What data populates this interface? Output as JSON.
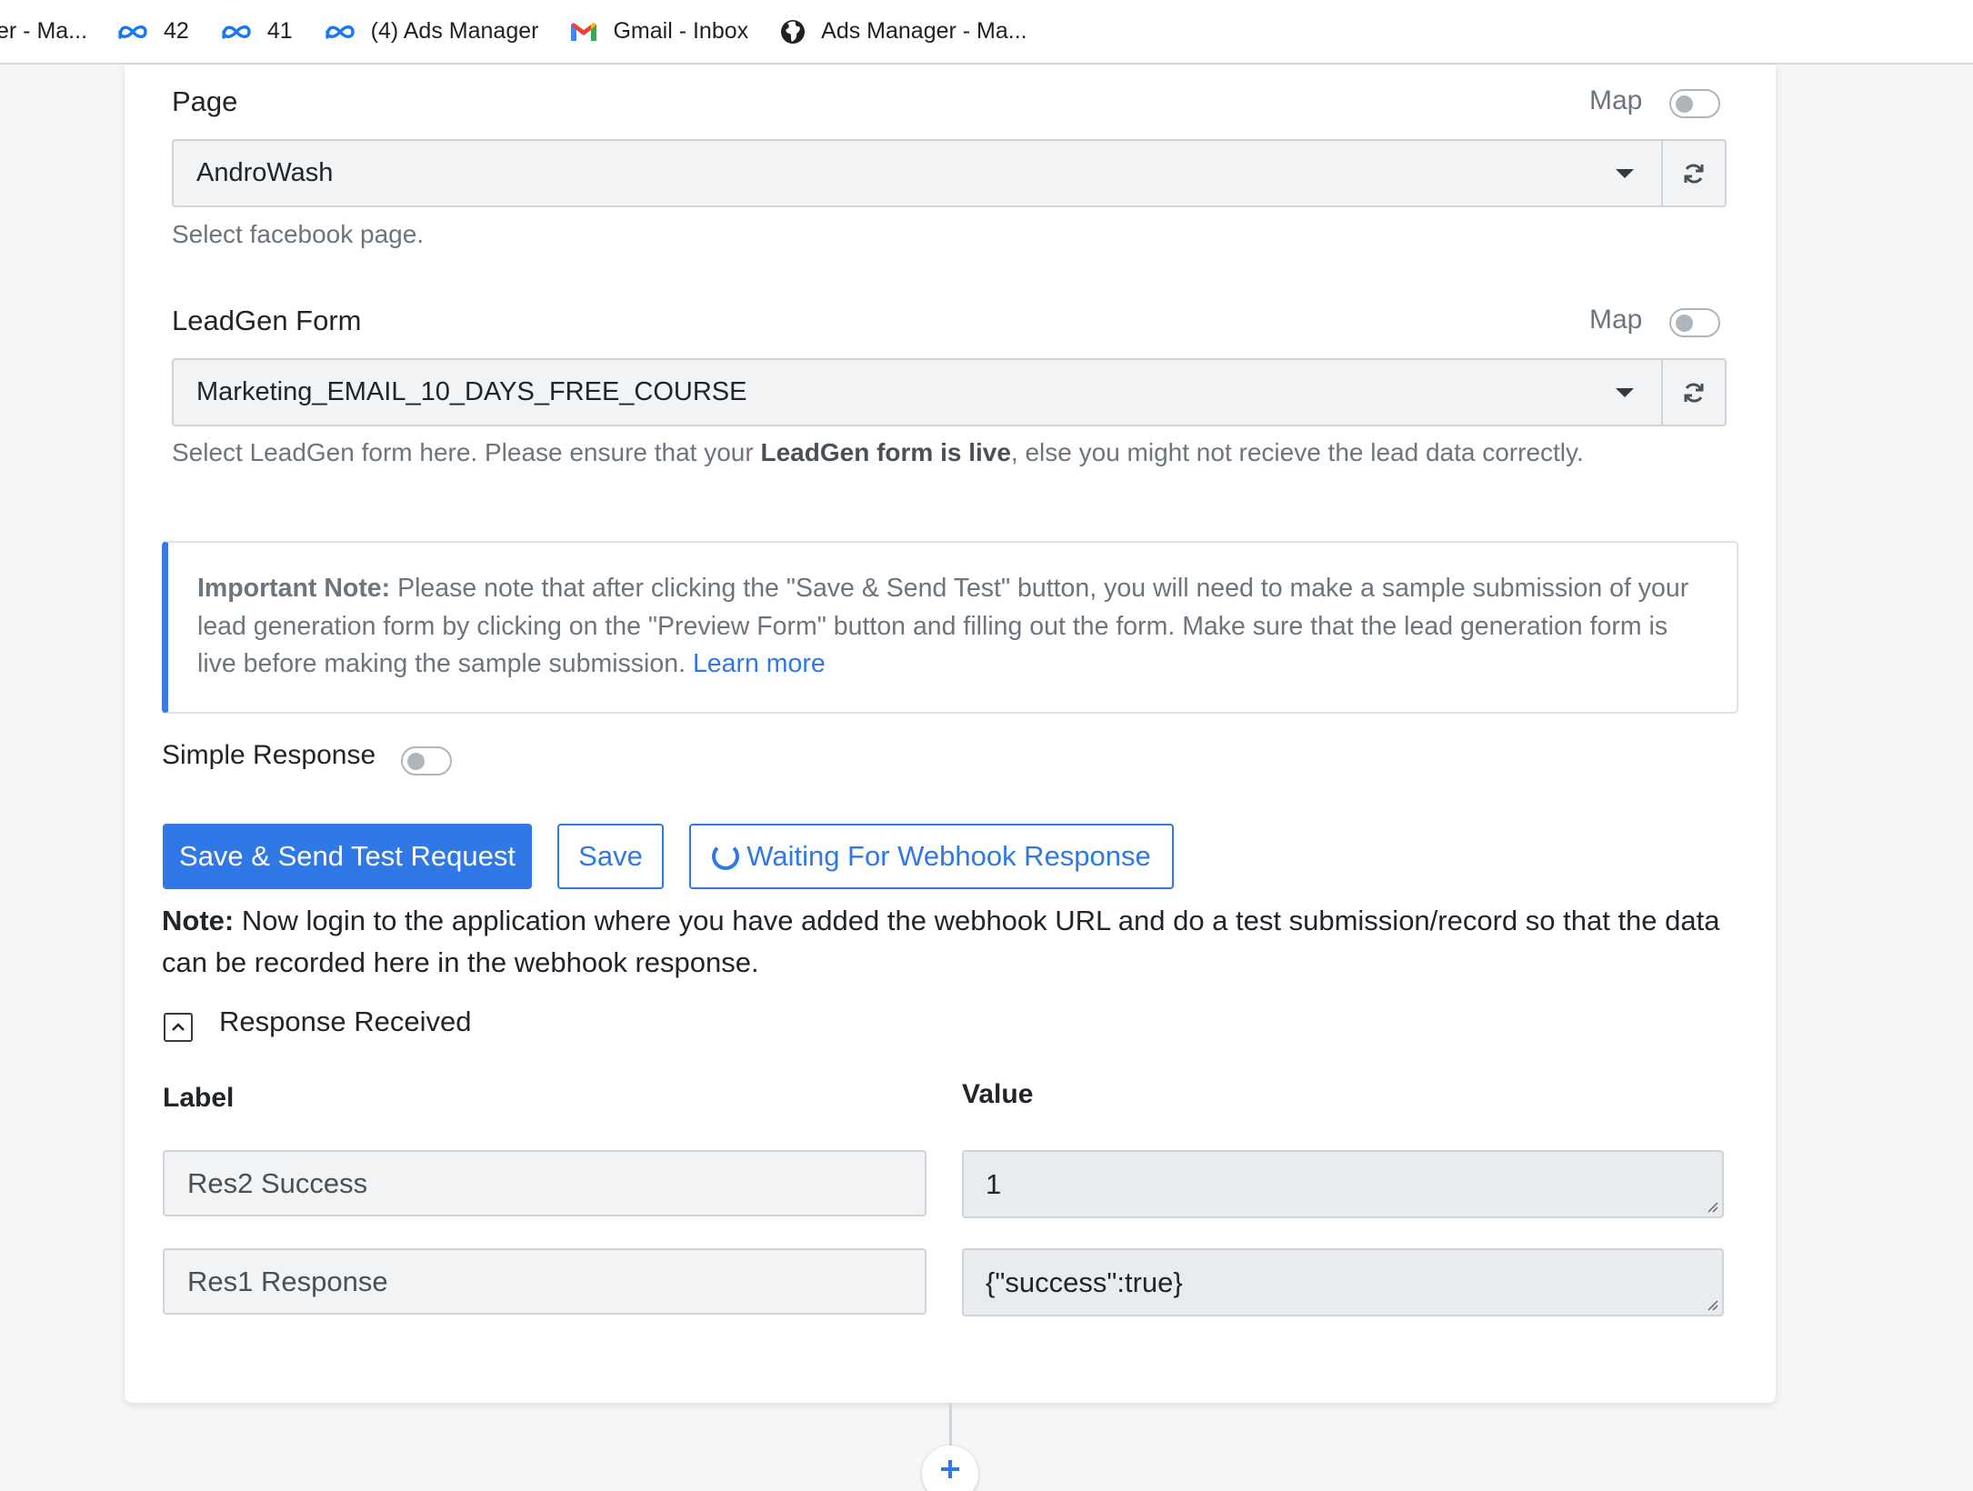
{
  "bookmarks": [
    {
      "label": "er - Ma...",
      "icon": "none"
    },
    {
      "label": "42",
      "icon": "meta-icon"
    },
    {
      "label": "41",
      "icon": "meta-icon"
    },
    {
      "label": "(4) Ads Manager",
      "icon": "meta-icon"
    },
    {
      "label": "Gmail - Inbox",
      "icon": "gmail-icon"
    },
    {
      "label": "Ads Manager - Ma...",
      "icon": "globe-icon"
    }
  ],
  "page_field": {
    "label": "Page",
    "map_label": "Map",
    "map_enabled": false,
    "value": "AndroWash",
    "help": "Select facebook page."
  },
  "leadgen_field": {
    "label": "LeadGen Form",
    "map_label": "Map",
    "map_enabled": false,
    "value": "Marketing_EMAIL_10_DAYS_FREE_COURSE",
    "help_prefix": "Select LeadGen form here. Please ensure that your ",
    "help_bold": "LeadGen form is live",
    "help_suffix": ", else you might not recieve the lead data correctly."
  },
  "important_note": {
    "title": "Important Note:",
    "text": " Please note that after clicking the \"Save & Send Test\" button, you will need to make a sample submission of your lead generation form by clicking on the \"Preview Form\" button and filling out the form. Make sure that the lead generation form is live before making the sample submission. ",
    "link": "Learn more"
  },
  "simple_response": {
    "label": "Simple Response",
    "enabled": false
  },
  "buttons": {
    "save_send": "Save & Send Test Request",
    "save": "Save",
    "waiting": "Waiting For Webhook Response"
  },
  "note": {
    "title": "Note:",
    "text": " Now login to the application where you have added the webhook URL and do a test submission/record so that the data can be recorded here in the webhook response."
  },
  "response": {
    "title": "Response Received",
    "label_header": "Label",
    "value_header": "Value",
    "rows": [
      {
        "label": "Res2 Success",
        "value": "1"
      },
      {
        "label": "Res1 Response",
        "value": "{\"success\":true}"
      }
    ]
  },
  "colors": {
    "primary": "#2f78e6",
    "note_border": "#3a7be0",
    "muted_text": "#6c757d"
  }
}
